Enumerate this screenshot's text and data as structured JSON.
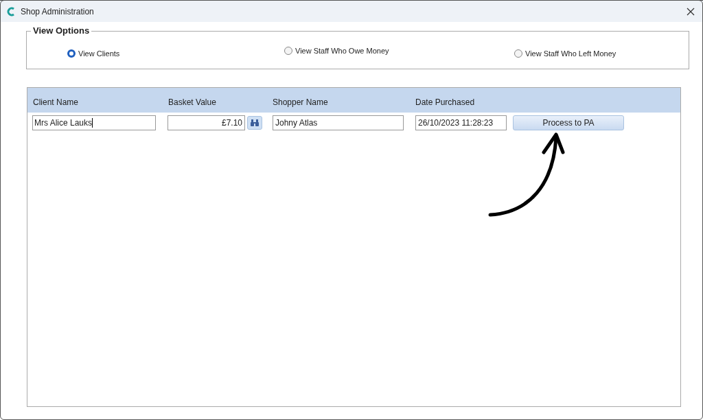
{
  "window": {
    "title": "Shop Administration"
  },
  "view_options": {
    "title": "View Options",
    "options": [
      {
        "label": "View Clients",
        "selected": true
      },
      {
        "label": "View Staff Who Owe Money",
        "selected": false
      },
      {
        "label": "View Staff Who Left Money",
        "selected": false
      }
    ]
  },
  "table": {
    "columns": [
      "Client Name",
      "Basket Value",
      "Shopper Name",
      "Date Purchased"
    ],
    "row": {
      "client_name": "Mrs Alice Lauks",
      "basket_value": "£7.10",
      "shopper_name": "Johny Atlas",
      "date_purchased": "26/10/2023 11:28:23",
      "button": "Process to PA"
    }
  }
}
